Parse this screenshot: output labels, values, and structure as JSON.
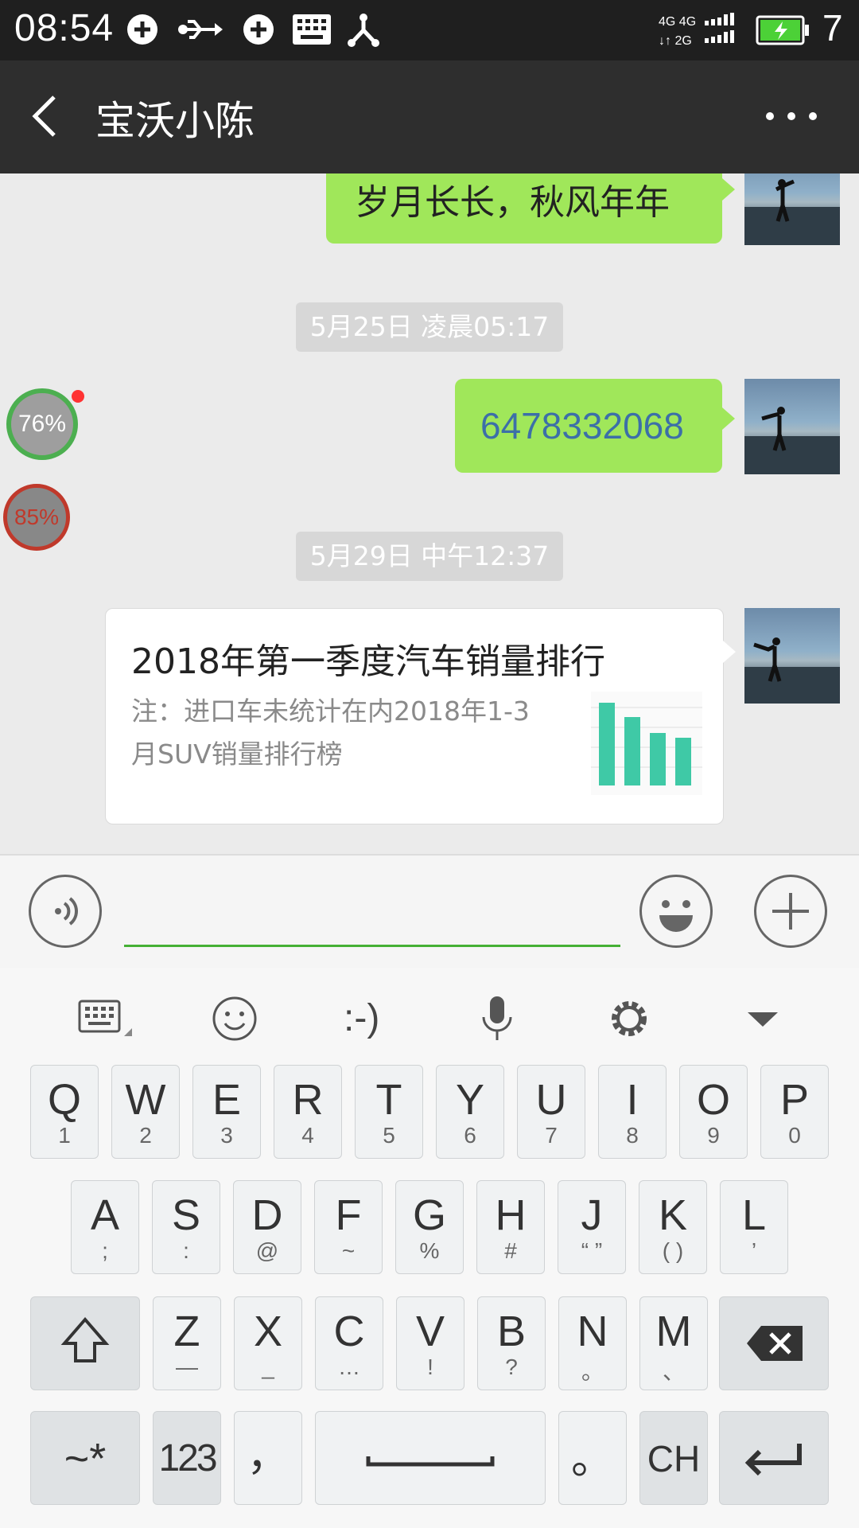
{
  "status_bar": {
    "time": "08:54",
    "network_label_top": "4G 4G",
    "network_label_bottom": "2G",
    "battery_level": "7"
  },
  "header": {
    "title": "宝沃小陈"
  },
  "messages": {
    "msg1_text": "岁月长长，秋风年年",
    "stamp1": "5月25日 凌晨05:17",
    "msg2_text": "6478332068",
    "stamp2": "5月29日 中午12:37",
    "card_title": "2018年第一季度汽车销量排行",
    "card_desc_line1": "注：进口车未统计在内2018年1-3",
    "card_desc_line2": "月SUV销量排行榜"
  },
  "floating": {
    "badge1": "76%",
    "badge2": "85%"
  },
  "keyboard": {
    "toolbar": [
      "keyboard-icon",
      "smiley-icon",
      ":-)",
      "microphone-icon",
      "settings-icon",
      "dropdown-icon"
    ],
    "emoticon_label": ":-)",
    "row1": [
      {
        "m": "Q",
        "s": "1"
      },
      {
        "m": "W",
        "s": "2"
      },
      {
        "m": "E",
        "s": "3"
      },
      {
        "m": "R",
        "s": "4"
      },
      {
        "m": "T",
        "s": "5"
      },
      {
        "m": "Y",
        "s": "6"
      },
      {
        "m": "U",
        "s": "7"
      },
      {
        "m": "I",
        "s": "8"
      },
      {
        "m": "O",
        "s": "9"
      },
      {
        "m": "P",
        "s": "0"
      }
    ],
    "row2": [
      {
        "m": "A",
        "s": ";"
      },
      {
        "m": "S",
        "s": ":"
      },
      {
        "m": "D",
        "s": "@"
      },
      {
        "m": "F",
        "s": "~"
      },
      {
        "m": "G",
        "s": "%"
      },
      {
        "m": "H",
        "s": "#"
      },
      {
        "m": "J",
        "s": "“ ”"
      },
      {
        "m": "K",
        "s": "( )"
      },
      {
        "m": "L",
        "s": "’"
      }
    ],
    "row3": [
      {
        "m": "Z",
        "s": "—"
      },
      {
        "m": "X",
        "s": "_"
      },
      {
        "m": "C",
        "s": "…"
      },
      {
        "m": "V",
        "s": "!"
      },
      {
        "m": "B",
        "s": "?"
      },
      {
        "m": "N",
        "s": "。"
      },
      {
        "m": "M",
        "s": "、"
      }
    ],
    "symbols_key": "~*",
    "num_key": "123",
    "comma_key": "，",
    "period_key": "。",
    "lang_key": "CH"
  }
}
